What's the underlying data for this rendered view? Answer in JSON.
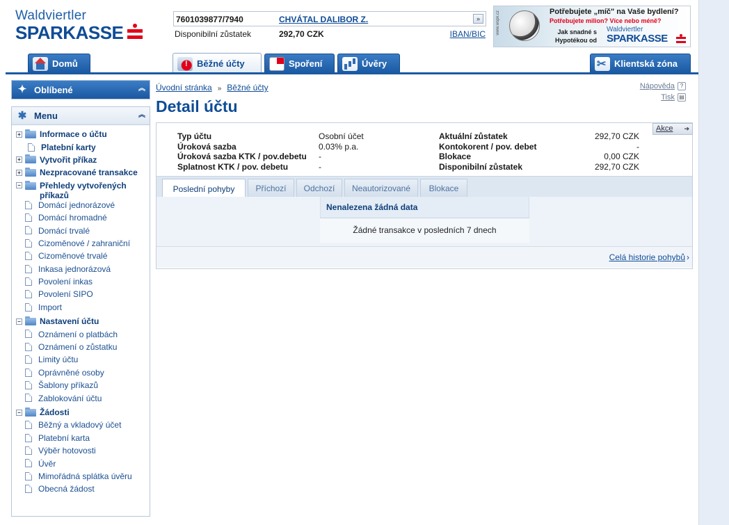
{
  "header": {
    "logo_line1": "Waldviertler",
    "logo_line2": "SPARKASSE",
    "account_number": "7601039877/7940",
    "account_holder": "CHVÁTAL DALIBOR Z.",
    "available_label": "Disponibilní zůstatek",
    "available_value": "292,70 CZK",
    "iban_link": "IBAN/BIC"
  },
  "banner": {
    "line1": "Potřebujete „míč\" na Vaše bydlení?",
    "line2": "Potřebujete milion? Více nebo méně?",
    "line3": "Jak snadné s Hypotékou od",
    "brand1": "Waldviertler",
    "brand2": "SPARKASSE",
    "vertical": "www.wspk.cz"
  },
  "nav": {
    "home": "Domů",
    "current": "Běžné účty",
    "savings": "Spoření",
    "loans": "Úvěry",
    "client": "Klientská zóna"
  },
  "sidebar": {
    "favorites": "Oblíbené",
    "menu": "Menu",
    "items": [
      {
        "label": "Informace o účtu"
      },
      {
        "label": "Platební karty"
      },
      {
        "label": "Vytvořit příkaz"
      },
      {
        "label": "Nezpracované transakce"
      },
      {
        "label": "Přehledy vytvořených příkazů"
      },
      {
        "label": "Domácí jednorázové"
      },
      {
        "label": "Domácí hromadné"
      },
      {
        "label": "Domácí trvalé"
      },
      {
        "label": "Cizoměnové / zahraniční"
      },
      {
        "label": "Cizoměnové trvalé"
      },
      {
        "label": "Inkasa jednorázová"
      },
      {
        "label": "Povolení inkas"
      },
      {
        "label": "Povolení SIPO"
      },
      {
        "label": "Import"
      },
      {
        "label": "Nastavení účtu"
      },
      {
        "label": "Oznámení o platbách"
      },
      {
        "label": "Oznámení o zůstatku"
      },
      {
        "label": "Limity účtu"
      },
      {
        "label": "Oprávněné osoby"
      },
      {
        "label": "Šablony příkazů"
      },
      {
        "label": "Zablokování účtu"
      },
      {
        "label": "Žádosti"
      },
      {
        "label": "Běžný a vkladový účet"
      },
      {
        "label": "Platební karta"
      },
      {
        "label": "Výběr hotovosti"
      },
      {
        "label": "Úvěr"
      },
      {
        "label": "Mimořádná splátka úvěru"
      },
      {
        "label": "Obecná žádost"
      }
    ]
  },
  "main": {
    "breadcrumb_home": "Úvodní stránka",
    "breadcrumb_current": "Běžné účty",
    "help": "Nápověda",
    "print": "Tisk",
    "title": "Detail účtu",
    "actions": "Akce",
    "left_details": [
      {
        "key": "Typ účtu",
        "value": "Osobní účet"
      },
      {
        "key": "Úroková sazba",
        "value": "0.03% p.a."
      },
      {
        "key": "Úroková sazba KTK / pov.debetu",
        "value": "-"
      },
      {
        "key": "Splatnost KTK / pov. debetu",
        "value": "-"
      }
    ],
    "right_details": [
      {
        "key": "Aktuální zůstatek",
        "value": "292,70 CZK"
      },
      {
        "key": "Kontokorent / pov. debet",
        "value": "-"
      },
      {
        "key": "Blokace",
        "value": "0,00 CZK"
      },
      {
        "key": "Disponibilní zůstatek",
        "value": "292,70 CZK"
      }
    ],
    "tabs": [
      {
        "label": "Poslední pohyby"
      },
      {
        "label": "Příchozí"
      },
      {
        "label": "Odchozí"
      },
      {
        "label": "Neautorizované"
      },
      {
        "label": "Blokace"
      }
    ],
    "no_data_title": "Nenalezena žádná data",
    "no_data_text": "Žádné transakce v posledních 7 dnech",
    "history_link": "Celá historie pohybů"
  },
  "colors": {
    "brand_blue": "#0f4c96",
    "brand_red": "#e2001a"
  }
}
